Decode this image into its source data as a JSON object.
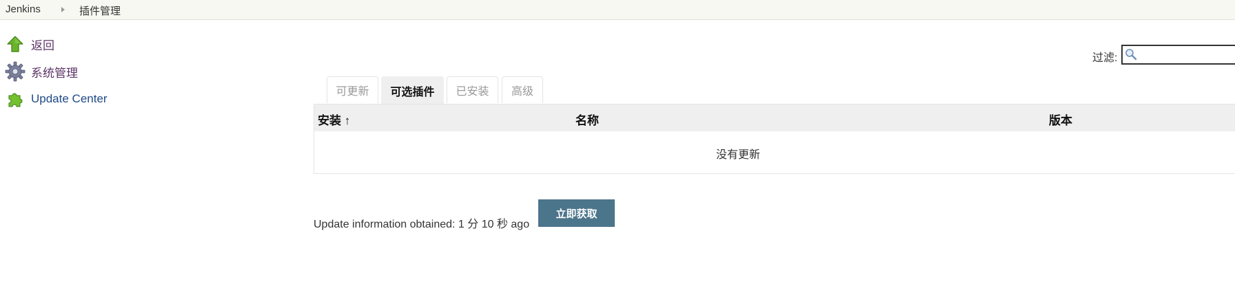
{
  "breadcrumb": {
    "items": [
      "Jenkins",
      "插件管理"
    ]
  },
  "sidebar": {
    "items": [
      {
        "label": "返回",
        "icon": "up-arrow-icon"
      },
      {
        "label": "系统管理",
        "icon": "gear-icon"
      },
      {
        "label": "Update Center",
        "icon": "puzzle-icon"
      }
    ]
  },
  "filter": {
    "label": "过滤:",
    "value": ""
  },
  "tabs": [
    {
      "label": "可更新",
      "active": false
    },
    {
      "label": "可选插件",
      "active": true
    },
    {
      "label": "已安装",
      "active": false
    },
    {
      "label": "高级",
      "active": false
    }
  ],
  "table": {
    "columns": [
      "安装 ↑",
      "名称",
      "版本"
    ],
    "empty_message": "没有更新"
  },
  "update": {
    "info_text": "Update information obtained: 1 分 10 秒 ago",
    "button_label": "立即获取"
  },
  "colors": {
    "accent_button": "#4b758b",
    "sidebar_link_visited": "#5c3566",
    "sidebar_link": "#204a87",
    "breadcrumb_bg": "#f8f8f3"
  }
}
